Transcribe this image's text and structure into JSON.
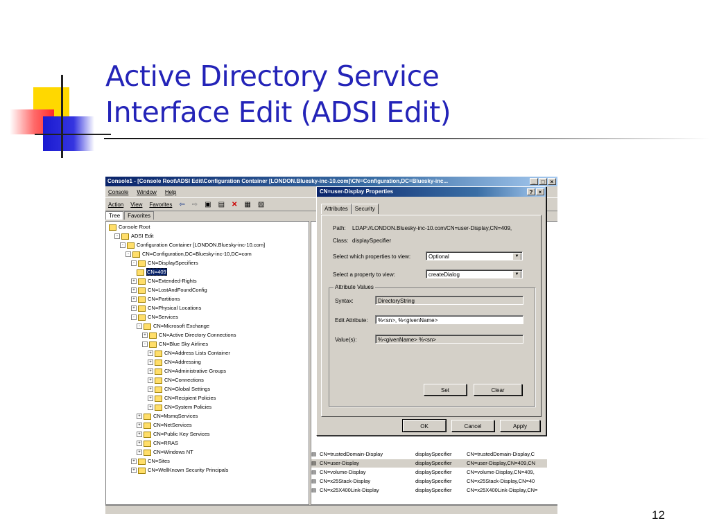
{
  "slide": {
    "title_line1": "Active Directory Service",
    "title_line2": "Interface Edit (ADSI Edit)",
    "page_number": "12"
  },
  "window": {
    "title": "Console1 - [Console Root\\ADSI Edit\\Configuration Container [LONDON.Bluesky-inc-10.com]\\CN=Configuration,DC=Bluesky-inc...",
    "menus": [
      "Console",
      "Window",
      "Help"
    ],
    "action_menus": [
      "Action",
      "View",
      "Favorites"
    ],
    "tree_tabs": [
      "Tree",
      "Favorites"
    ],
    "tree": [
      {
        "label": "Console Root",
        "indent": 0,
        "pm": ""
      },
      {
        "label": "ADSI Edit",
        "indent": 1,
        "pm": "-"
      },
      {
        "label": "Configuration Container [LONDON.Bluesky-inc-10.com]",
        "indent": 2,
        "pm": "-"
      },
      {
        "label": "CN=Configuration,DC=Bluesky-inc-10,DC=com",
        "indent": 3,
        "pm": "-"
      },
      {
        "label": "CN=DisplaySpecifiers",
        "indent": 4,
        "pm": "-"
      },
      {
        "label": "CN=409",
        "indent": 5,
        "pm": "",
        "selected": true
      },
      {
        "label": "CN=Extended-Rights",
        "indent": 4,
        "pm": "+"
      },
      {
        "label": "CN=LostAndFoundConfig",
        "indent": 4,
        "pm": "+"
      },
      {
        "label": "CN=Partitions",
        "indent": 4,
        "pm": "+"
      },
      {
        "label": "CN=Physical Locations",
        "indent": 4,
        "pm": "+"
      },
      {
        "label": "CN=Services",
        "indent": 4,
        "pm": "-"
      },
      {
        "label": "CN=Microsoft Exchange",
        "indent": 5,
        "pm": "-"
      },
      {
        "label": "CN=Active Directory Connections",
        "indent": 6,
        "pm": "+"
      },
      {
        "label": "CN=Blue Sky Airlines",
        "indent": 6,
        "pm": "-"
      },
      {
        "label": "CN=Address Lists Container",
        "indent": 7,
        "pm": "+"
      },
      {
        "label": "CN=Addressing",
        "indent": 7,
        "pm": "+"
      },
      {
        "label": "CN=Administrative Groups",
        "indent": 7,
        "pm": "+"
      },
      {
        "label": "CN=Connections",
        "indent": 7,
        "pm": "+"
      },
      {
        "label": "CN=Global Settings",
        "indent": 7,
        "pm": "+"
      },
      {
        "label": "CN=Recipient Policies",
        "indent": 7,
        "pm": "+"
      },
      {
        "label": "CN=System Policies",
        "indent": 7,
        "pm": "+"
      },
      {
        "label": "CN=MsmqServices",
        "indent": 5,
        "pm": "+"
      },
      {
        "label": "CN=NetServices",
        "indent": 5,
        "pm": "+"
      },
      {
        "label": "CN=Public Key Services",
        "indent": 5,
        "pm": "+"
      },
      {
        "label": "CN=RRAS",
        "indent": 5,
        "pm": "+"
      },
      {
        "label": "CN=Windows NT",
        "indent": 5,
        "pm": "+"
      },
      {
        "label": "CN=Sites",
        "indent": 4,
        "pm": "+"
      },
      {
        "label": "CN=WellKnown Security Principals",
        "indent": 4,
        "pm": "+"
      }
    ],
    "list_rows": [
      {
        "name": "CN=trustedDomain-Display",
        "class": "displaySpecifier",
        "dn": "CN=trustedDomain-Display,C"
      },
      {
        "name": "CN=user-Display",
        "class": "displaySpecifier",
        "dn": "CN=user-Display,CN=409,CN",
        "highlight": true
      },
      {
        "name": "CN=volume-Display",
        "class": "displaySpecifier",
        "dn": "CN=volume-Display,CN=409,"
      },
      {
        "name": "CN=x25Stack-Display",
        "class": "displaySpecifier",
        "dn": "CN=x25Stack-Display,CN=40"
      },
      {
        "name": "CN=x25X400Link-Display",
        "class": "displaySpecifier",
        "dn": "CN=x25X400Link-Display,CN="
      }
    ]
  },
  "dialog": {
    "title": "CN=user-Display Properties",
    "tabs": [
      "Attributes",
      "Security"
    ],
    "path_label": "Path:",
    "path_value": "LDAP://LONDON.Bluesky-inc-10.com/CN=user-Display,CN=409,",
    "class_label": "Class:",
    "class_value": "displaySpecifier",
    "which_props_label": "Select which properties to view:",
    "which_props_value": "Optional",
    "property_label": "Select a property to view:",
    "property_value": "createDialog",
    "group_label": "Attribute Values",
    "syntax_label": "Syntax:",
    "syntax_value": "DirectoryString",
    "edit_label": "Edit Attribute:",
    "edit_value": "%<sn>, %<givenName>",
    "values_label": "Value(s):",
    "values_value": "%<givenName> %<sn>",
    "set_button": "Set",
    "clear_button": "Clear",
    "ok_button": "OK",
    "cancel_button": "Cancel",
    "apply_button": "Apply"
  }
}
